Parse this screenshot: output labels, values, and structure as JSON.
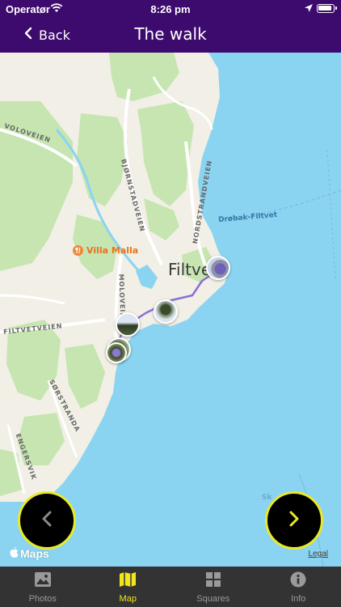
{
  "status_bar": {
    "carrier": "Operatør",
    "time": "8:26 pm"
  },
  "nav": {
    "back_label": "Back",
    "title": "The walk"
  },
  "map": {
    "place_label": "Filtvet",
    "poi_label": "Villa Malla",
    "water_label": "Drøbak-Filtvet",
    "water_label_2": "Sk",
    "roads": [
      "VOLOVEIEN",
      "BJØRNSTADVEIEN",
      "NORDSTRANDVEIEN",
      "MOLOVEIEN",
      "FILTVETVEIEN",
      "SØRSTRANDA",
      "ENGERSVIK"
    ],
    "maps_logo": "Maps",
    "legal": "Legal",
    "photo_pins": [
      "photo-pin-1",
      "photo-pin-2",
      "photo-pin-3",
      "photo-pin-4",
      "photo-pin-5"
    ]
  },
  "buttons": {
    "prev_icon": "chevron-left-icon",
    "next_icon": "chevron-right-icon"
  },
  "tabs": [
    {
      "label": "Photos",
      "icon": "photo-icon",
      "active": false
    },
    {
      "label": "Map",
      "icon": "map-icon",
      "active": true
    },
    {
      "label": "Squares",
      "icon": "grid-icon",
      "active": false
    },
    {
      "label": "Info",
      "icon": "info-icon",
      "active": false
    }
  ],
  "colors": {
    "header": "#3d0a6e",
    "accent": "#f2e51e",
    "water": "#8ad4f1",
    "tabbar": "#333333",
    "route": "#8a6fd6"
  }
}
